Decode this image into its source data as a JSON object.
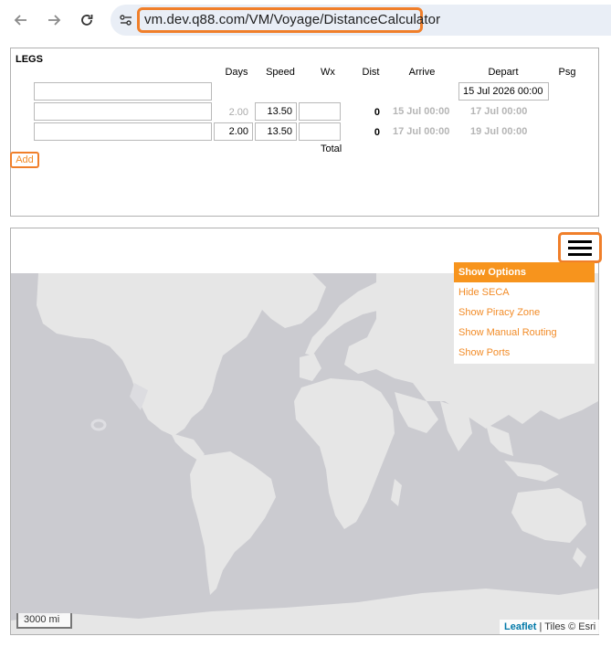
{
  "browser": {
    "url": "vm.dev.q88.com/VM/Voyage/DistanceCalculator"
  },
  "legs": {
    "title": "LEGS",
    "columns": [
      "Days",
      "Speed",
      "Wx",
      "Dist",
      "Arrive",
      "Depart",
      "Psg"
    ],
    "depart_first": "15 Jul 2026 00:00",
    "rows": [
      {
        "port": "",
        "days": "2.00",
        "speed": "13.50",
        "wx": "",
        "dist": "0",
        "arrive": "15 Jul 00:00",
        "depart": "17 Jul 00:00"
      },
      {
        "port": "",
        "days": "2.00",
        "speed": "13.50",
        "wx": "",
        "dist": "0",
        "arrive": "17 Jul 00:00",
        "depart": "19 Jul 00:00"
      }
    ],
    "total_label": "Total",
    "add_label": "Add"
  },
  "map": {
    "menu_options": [
      "Show Options",
      "Hide SECA",
      "Show Piracy Zone",
      "Show Manual Routing",
      "Show Ports"
    ],
    "scale_label": "3000 mi",
    "attribution_link": "Leaflet",
    "attribution_text": " | Tiles © Esri"
  },
  "colors": {
    "accent": "#f07f2a",
    "menu_active": "#f7941d",
    "ocean": "#cbcbd0",
    "land": "#e6e6e6"
  }
}
